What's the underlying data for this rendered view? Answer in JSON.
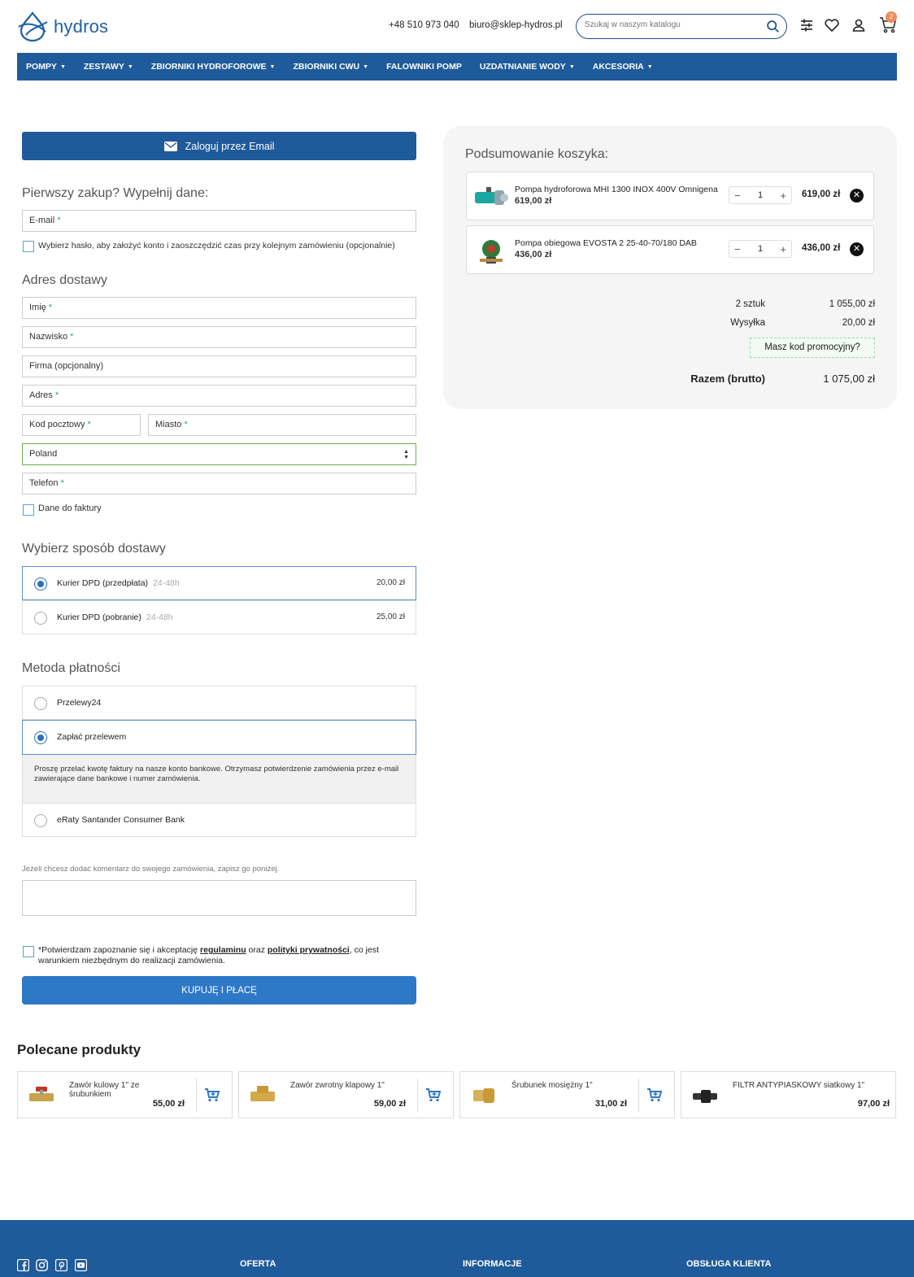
{
  "header": {
    "logo_text": "hydros",
    "phone": "+48 510 973 040",
    "email": "biuro@sklep-hydros.pl",
    "search_placeholder": "Szukaj w naszym katalogu",
    "cart_count": "2"
  },
  "nav": {
    "items": [
      {
        "label": "POMPY",
        "caret": "▼"
      },
      {
        "label": "ZESTAWY",
        "caret": "▼"
      },
      {
        "label": "ZBIORNIKI HYDROFOROWE",
        "caret": "▼"
      },
      {
        "label": "ZBIORNIKI CWU",
        "caret": "▼"
      },
      {
        "label": "FALOWNIKI POMP",
        "caret": ""
      },
      {
        "label": "UZDATNIANIE WODY",
        "caret": "▼"
      },
      {
        "label": "AKCESORIA",
        "caret": "▼"
      }
    ]
  },
  "login": {
    "button_label": "Zaloguj przez Email"
  },
  "first_purchase": {
    "title": "Pierwszy zakup? Wypełnij dane:",
    "email_label": "E-mail",
    "password_checkbox": "Wybierz hasło, aby założyć konto i zaoszczędzić czas przy kolejnym zamówieniu (opcjonalnie)"
  },
  "address": {
    "title": "Adres dostawy",
    "first_name": "Imię",
    "last_name": "Nazwisko",
    "company": "Firma (opcjonalny)",
    "street": "Adres",
    "postal_code": "Kod pocztowy",
    "city": "Miasto",
    "country": "Poland",
    "phone": "Telefon",
    "invoice_checkbox": "Dane do faktury",
    "required_mark": "*"
  },
  "shipping": {
    "title": "Wybierz sposób dostawy",
    "options": [
      {
        "label": "Kurier DPD (przedpłata)",
        "time": "24-48h",
        "price": "20,00 zł",
        "selected": true
      },
      {
        "label": "Kurier DPD (pobranie)",
        "time": "24-48h",
        "price": "25,00 zł",
        "selected": false
      }
    ]
  },
  "payment": {
    "title": "Metoda płatności",
    "options": [
      {
        "label": "Przelewy24",
        "selected": false
      },
      {
        "label": "Zapłać przelewem",
        "selected": true
      },
      {
        "label": "eRaty Santander Consumer Bank",
        "selected": false
      }
    ],
    "transfer_info": "Proszę przelać kwotę faktury na nasze konto bankowe. Otrzymasz potwierdzenie zamówienia przez e-mail zawierające dane bankowe i numer zamówienia."
  },
  "comment": {
    "label": "Jeżeli chcesz dodać komentarz do swojego zamówienia, zapisz go poniżej."
  },
  "terms": {
    "prefix": "*Potwierdzam zapoznanie się i akceptację ",
    "link1": "regulaminu",
    "middle": " oraz ",
    "link2": "polityki prywatności",
    "suffix": ", co jest warunkiem niezbędnym do realizacji zamówienia."
  },
  "buy_button": "KUPUJĘ I PŁACĘ",
  "summary": {
    "title": "Podsumowanie koszyka:",
    "items": [
      {
        "name": "Pompa hydroforowa MHI 1300 INOX 400V Omnigena",
        "unit_price": "619,00 zł",
        "qty": "1",
        "total": "619,00 zł"
      },
      {
        "name": "Pompa obiegowa EVOSTA 2 25-40-70/180 DAB",
        "unit_price": "436,00 zł",
        "qty": "1",
        "total": "436,00 zł"
      }
    ],
    "count_label": "2 sztuk",
    "count_value": "1 055,00 zł",
    "shipping_label": "Wysyłka",
    "shipping_value": "20,00 zł",
    "promo_label": "Masz kod promocyjny?",
    "total_label": "Razem (brutto)",
    "total_value": "1 075,00 zł",
    "qty_minus": "−",
    "qty_plus": "+",
    "remove_symbol": "✕"
  },
  "recommended": {
    "title": "Polecane produkty",
    "items": [
      {
        "name": "Zawór kulowy 1\" ze śrubunkiem",
        "price": "55,00 zł"
      },
      {
        "name": "Zawór zwrotny klapowy 1\"",
        "price": "59,00 zł"
      },
      {
        "name": "Śrubunek mosiężny 1\"",
        "price": "31,00 zł"
      },
      {
        "name": "FILTR ANTYPIASKOWY siatkowy 1\"",
        "price": "97,00 zł"
      }
    ]
  },
  "footer": {
    "headings": [
      "OFERTA",
      "INFORMACJE",
      "OBSŁUGA KLIENTA"
    ]
  },
  "colors": {
    "brand_blue": "#1f5a9a",
    "button_blue": "#2e78c8",
    "badge_orange": "#f08a5d"
  }
}
